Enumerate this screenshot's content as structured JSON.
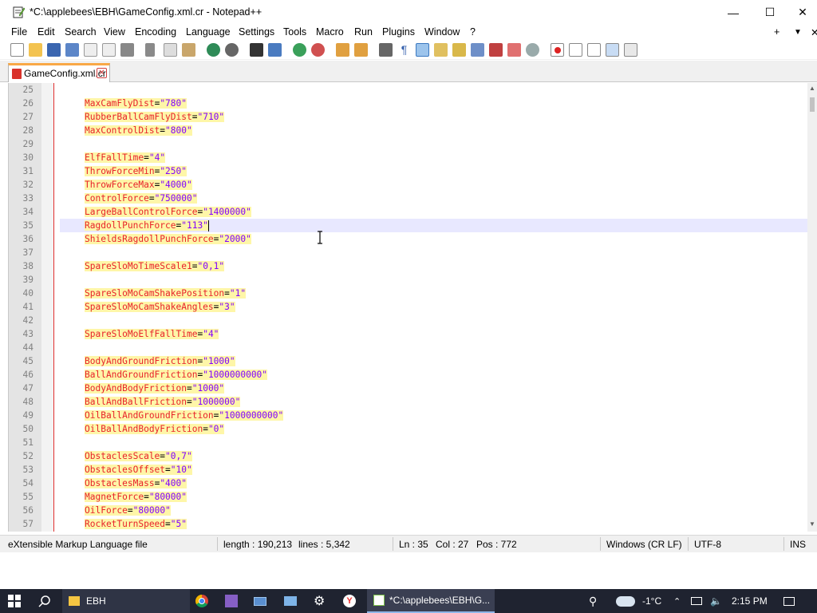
{
  "window": {
    "title": "*C:\\applebees\\EBH\\GameConfig.xml.cr - Notepad++",
    "minimize_glyph": "—",
    "maximize_glyph": "☐",
    "close_glyph": "✕"
  },
  "menu": {
    "items": [
      "File",
      "Edit",
      "Search",
      "View",
      "Encoding",
      "Language",
      "Settings",
      "Tools",
      "Macro",
      "Run",
      "Plugins",
      "Window",
      "?"
    ],
    "plus": "+",
    "down": "▼",
    "close": "✕"
  },
  "tab": {
    "label": "GameConfig.xml.cr",
    "close": "✕"
  },
  "editor": {
    "lines": [
      {
        "n": "25",
        "attr": "",
        "val": ""
      },
      {
        "n": "26",
        "attr": "MaxCamFlyDist",
        "val": "\"780\""
      },
      {
        "n": "27",
        "attr": "RubberBallCamFlyDist",
        "val": "\"710\""
      },
      {
        "n": "28",
        "attr": "MaxControlDist",
        "val": "\"800\""
      },
      {
        "n": "29",
        "attr": "",
        "val": ""
      },
      {
        "n": "30",
        "attr": "ElfFallTime",
        "val": "\"4\""
      },
      {
        "n": "31",
        "attr": "ThrowForceMin",
        "val": "\"250\""
      },
      {
        "n": "32",
        "attr": "ThrowForceMax",
        "val": "\"4000\""
      },
      {
        "n": "33",
        "attr": "ControlForce",
        "val": "\"750000\""
      },
      {
        "n": "34",
        "attr": "LargeBallControlForce",
        "val": "\"1400000\""
      },
      {
        "n": "35",
        "attr": "RagdollPunchForce",
        "val": "\"113\"",
        "current": true
      },
      {
        "n": "36",
        "attr": "ShieldsRagdollPunchForce",
        "val": "\"2000\""
      },
      {
        "n": "37",
        "attr": "",
        "val": ""
      },
      {
        "n": "38",
        "attr": "SpareSloMoTimeScale1",
        "val": "\"0,1\""
      },
      {
        "n": "39",
        "attr": "",
        "val": ""
      },
      {
        "n": "40",
        "attr": "SpareSloMoCamShakePosition",
        "val": "\"1\""
      },
      {
        "n": "41",
        "attr": "SpareSloMoCamShakeAngles",
        "val": "\"3\""
      },
      {
        "n": "42",
        "attr": "",
        "val": ""
      },
      {
        "n": "43",
        "attr": "SpareSloMoElfFallTime",
        "val": "\"4\""
      },
      {
        "n": "44",
        "attr": "",
        "val": ""
      },
      {
        "n": "45",
        "attr": "BodyAndGroundFriction",
        "val": "\"1000\""
      },
      {
        "n": "46",
        "attr": "BallAndGroundFriction",
        "val": "\"1000000000\""
      },
      {
        "n": "47",
        "attr": "BodyAndBodyFriction",
        "val": "\"1000\""
      },
      {
        "n": "48",
        "attr": "BallAndBallFriction",
        "val": "\"1000000\""
      },
      {
        "n": "49",
        "attr": "OilBallAndGroundFriction",
        "val": "\"1000000000\""
      },
      {
        "n": "50",
        "attr": "OilBallAndBodyFriction",
        "val": "\"0\""
      },
      {
        "n": "51",
        "attr": "",
        "val": ""
      },
      {
        "n": "52",
        "attr": "ObstaclesScale",
        "val": "\"0,7\""
      },
      {
        "n": "53",
        "attr": "ObstaclesOffset",
        "val": "\"10\""
      },
      {
        "n": "54",
        "attr": "ObstaclesMass",
        "val": "\"400\""
      },
      {
        "n": "55",
        "attr": "MagnetForce",
        "val": "\"80000\""
      },
      {
        "n": "56",
        "attr": "OilForce",
        "val": "\"80000\""
      },
      {
        "n": "57",
        "attr": "RocketTurnSpeed",
        "val": "\"5\""
      }
    ]
  },
  "status": {
    "filetype": "eXtensible Markup Language file",
    "length": "length : 190,213",
    "lines": "lines : 5,342",
    "ln": "Ln : 35",
    "col": "Col : 27",
    "pos": "Pos : 772",
    "eol": "Windows (CR LF)",
    "encoding": "UTF-8",
    "mode": "INS"
  },
  "taskbar": {
    "folder_label": "EBH",
    "npp_label": "*C:\\applebees\\EBH\\G...",
    "temperature": "-1°C",
    "time": "2:15 PM"
  },
  "colors": {
    "attr": "#e8222a",
    "value": "#8000ff",
    "highlight": "#fef6a8",
    "current_line": "#e8e8ff",
    "tab_accent": "#f9a846"
  }
}
